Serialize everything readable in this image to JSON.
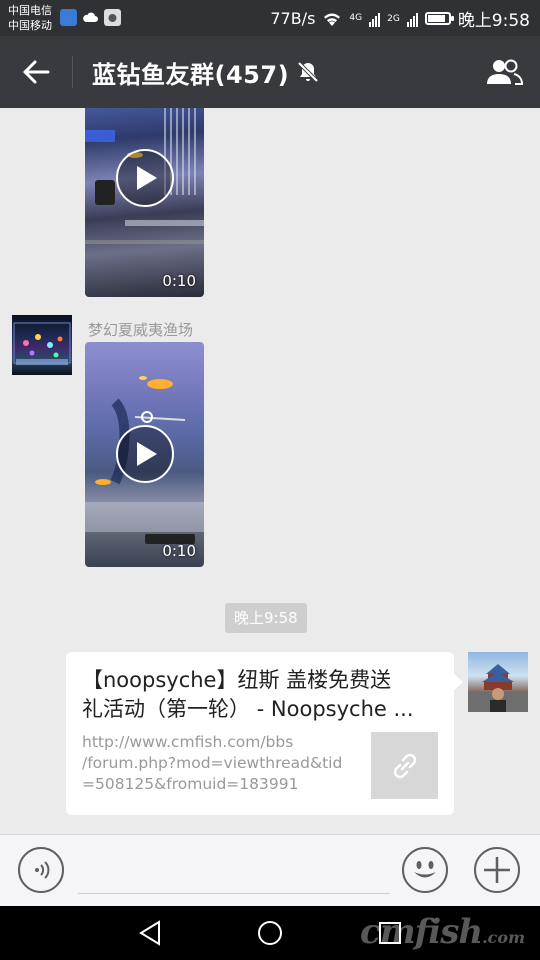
{
  "status_bar": {
    "carrier_1": "中国电信",
    "carrier_2": "中国移动",
    "speed": "77B/s",
    "net_1": "4G",
    "net_2": "2G",
    "time": "晚上9:58",
    "icons": [
      "app-notification-icon",
      "cloud-icon",
      "app-notification-icon",
      "wifi-icon",
      "signal-icon",
      "signal-icon",
      "battery-icon"
    ]
  },
  "titlebar": {
    "title": "蓝钻鱼友群(457)",
    "back_icon": "arrow-left-icon",
    "mute_icon": "bell-off-icon",
    "members_icon": "group-members-icon"
  },
  "messages": [
    {
      "type": "video",
      "direction": "incoming",
      "duration": "0:10"
    },
    {
      "type": "video",
      "direction": "incoming",
      "sender": "梦幻夏威夷渔场",
      "duration": "0:10"
    },
    {
      "type": "timestamp",
      "text": "晚上9:58"
    },
    {
      "type": "link",
      "direction": "outgoing",
      "title_line_1": "【noopsyche】纽斯 盖楼免费送",
      "title_line_2": "礼活动（第一轮） - Noopsyche ...",
      "url_line_1": "http://www.cmfish.com/bbs",
      "url_line_2": "/forum.php?mod=viewthread&tid",
      "url_line_3": "=508125&fromuid=183991",
      "thumb_icon": "link-icon"
    }
  ],
  "input_bar": {
    "voice_icon": "voice-input-icon",
    "emoji_icon": "emoji-icon",
    "plus_icon": "plus-icon"
  },
  "nav_bar": {
    "back_icon": "nav-back-icon",
    "home_icon": "nav-home-icon",
    "recent_icon": "nav-recent-icon"
  },
  "watermark": {
    "main": "cmfish",
    "suffix": ".com"
  },
  "colors": {
    "titlebar": "#393a3f",
    "statusbar": "#2f3134",
    "chat_background": "#ebebeb",
    "bubble": "#ffffff",
    "timestamp_badge": "#cecece"
  }
}
